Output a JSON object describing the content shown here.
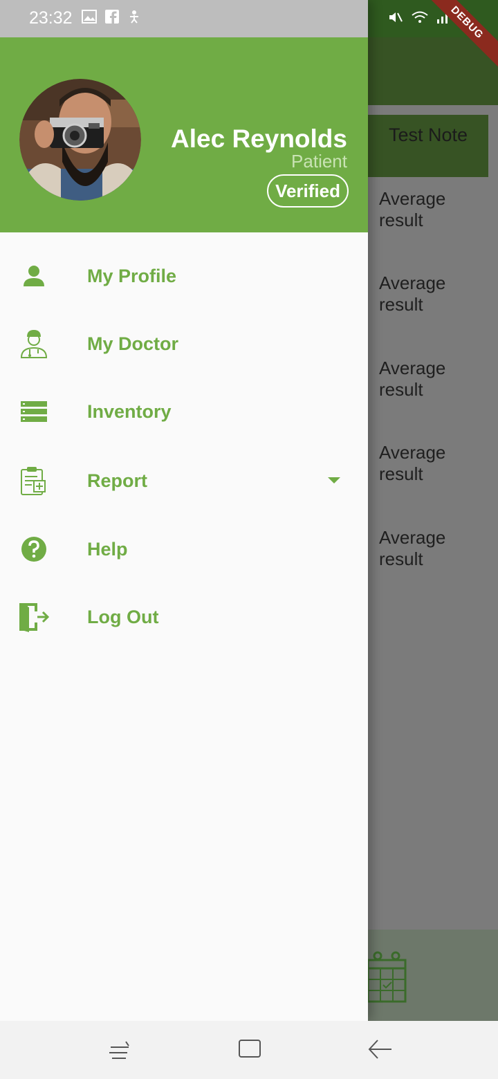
{
  "status_bar": {
    "time": "23:32",
    "debug_label": "DEBUG"
  },
  "background": {
    "note_title": "Test Note",
    "results": [
      "Average result",
      "Average result",
      "Average result",
      "Average result",
      "Average result"
    ]
  },
  "drawer": {
    "user": {
      "name": "Alec Reynolds",
      "role": "Patient",
      "badge": "Verified"
    },
    "menu": [
      {
        "label": "My Profile",
        "icon": "person-icon"
      },
      {
        "label": "My Doctor",
        "icon": "doctor-icon"
      },
      {
        "label": "Inventory",
        "icon": "inventory-list-icon"
      },
      {
        "label": "Report",
        "icon": "clipboard-medical-icon",
        "has_dropdown": true
      },
      {
        "label": "Help",
        "icon": "help-circle-icon"
      },
      {
        "label": "Log Out",
        "icon": "logout-door-icon"
      }
    ]
  },
  "colors": {
    "accent": "#70ac45",
    "header_bg": "#70ac45",
    "role_text": "#c9e3b4",
    "drawer_bg": "#fafafa"
  }
}
